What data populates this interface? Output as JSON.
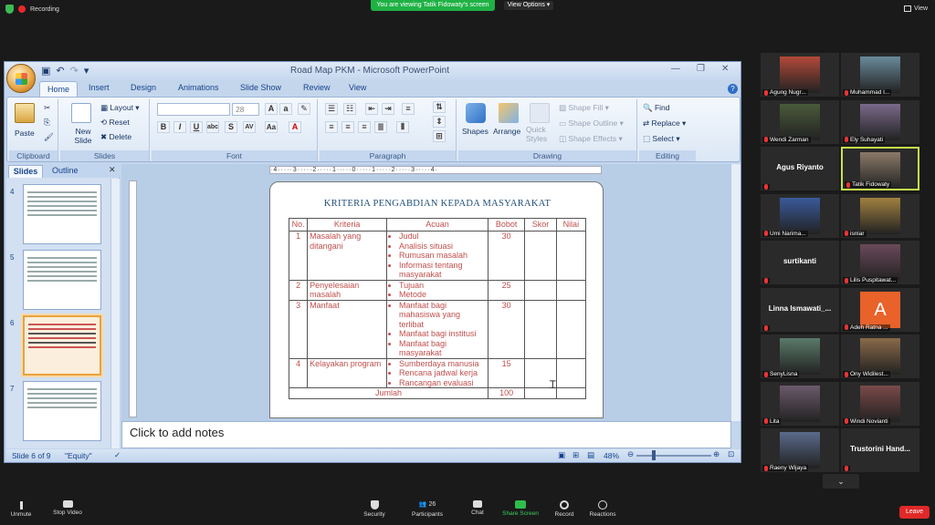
{
  "zoom": {
    "recording": "Recording",
    "viewing": "You are viewing Tatik Fidowaty's screen",
    "view_options": "View Options",
    "view": "View",
    "leave": "Leave",
    "bottom_buttons": [
      "Unmute",
      "Stop Video",
      "Security",
      "Participants",
      "Chat",
      "Share Screen",
      "Record",
      "Reactions"
    ],
    "participants_count": "26"
  },
  "ppt": {
    "title": "Road Map PKM - Microsoft PowerPoint",
    "tabs": [
      "Home",
      "Insert",
      "Design",
      "Animations",
      "Slide Show",
      "Review",
      "View"
    ],
    "ribbon": {
      "clipboard": {
        "label": "Clipboard",
        "paste": "Paste"
      },
      "slides": {
        "label": "Slides",
        "new_slide": "New Slide",
        "layout": "Layout",
        "reset": "Reset",
        "delete": "Delete"
      },
      "font": {
        "label": "Font",
        "size": "28"
      },
      "paragraph": {
        "label": "Paragraph"
      },
      "drawing": {
        "label": "Drawing",
        "shapes": "Shapes",
        "arrange": "Arrange",
        "quick_styles": "Quick Styles",
        "shape_fill": "Shape Fill",
        "shape_outline": "Shape Outline",
        "shape_effects": "Shape Effects"
      },
      "editing": {
        "label": "Editing",
        "find": "Find",
        "replace": "Replace",
        "select": "Select"
      }
    },
    "panel": {
      "slides_tab": "Slides",
      "outline_tab": "Outline",
      "thumb_numbers": [
        "4",
        "5",
        "6",
        "7"
      ]
    },
    "notes_placeholder": "Click to add notes",
    "status": {
      "slide_of": "Slide 6 of 9",
      "theme": "\"Equity\"",
      "zoom": "48%"
    }
  },
  "slide": {
    "title": "KRITERIA PENGABDIAN KEPADA  MASYARAKAT",
    "headers": [
      "No.",
      "Kriteria",
      "Acuan",
      "Bobot",
      "Skor",
      "Nilai"
    ],
    "rows": [
      {
        "no": "1",
        "kriteria": "Masalah yang ditangani",
        "acuan": [
          "Judul",
          "Analisis situasi",
          "Rumusan masalah",
          "Informasi tentang masyarakat"
        ],
        "bobot": "30"
      },
      {
        "no": "2",
        "kriteria": "Penyelesaian masalah",
        "acuan": [
          "Tujuan",
          "Metode"
        ],
        "bobot": "25"
      },
      {
        "no": "3",
        "kriteria": "Manfaat",
        "acuan": [
          "Manfaat bagi mahasiswa yang terlibat",
          "Manfaat bagi institusi",
          "Manfaat bagi masyarakat"
        ],
        "bobot": "30"
      },
      {
        "no": "4",
        "kriteria": "Kelayakan program",
        "acuan": [
          "Sumberdaya manusia",
          "Rencana jadwal kerja",
          "Rancangan evaluasi"
        ],
        "bobot": "15"
      }
    ],
    "total_label": "Jumlah",
    "total": "100"
  },
  "participants": [
    {
      "name": "Agung Nugr...",
      "type": "video"
    },
    {
      "name": "Muhammad I...",
      "type": "video"
    },
    {
      "name": "Wendi Zarman",
      "type": "video"
    },
    {
      "name": "Ely Suhayati",
      "type": "video"
    },
    {
      "name": "Agus Riyanto",
      "type": "name"
    },
    {
      "name": "Tatik Fidowaty",
      "type": "video"
    },
    {
      "name": "Umi Narima...",
      "type": "video"
    },
    {
      "name": "isniar",
      "type": "video"
    },
    {
      "name": "surtikanti",
      "type": "name"
    },
    {
      "name": "Lilis Puspitawat...",
      "type": "video"
    },
    {
      "name": "Linna  Ismawati_...",
      "type": "name"
    },
    {
      "name": "Adeh Ratna ...",
      "type": "avatar",
      "letter": "A"
    },
    {
      "name": "SenyLisna",
      "type": "video"
    },
    {
      "name": "Ony Widilest...",
      "type": "video"
    },
    {
      "name": "Lita",
      "type": "video"
    },
    {
      "name": "Windi Novianti",
      "type": "video"
    },
    {
      "name": "Raeny Wijaya",
      "type": "video"
    },
    {
      "name": "Trustorini  Hand...",
      "type": "name"
    }
  ]
}
